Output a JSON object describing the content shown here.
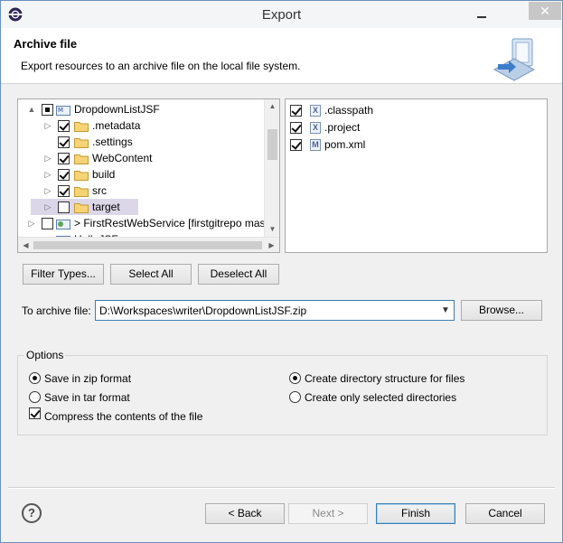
{
  "window": {
    "title": "Export",
    "close_glyph": "✕"
  },
  "banner": {
    "title": "Archive file",
    "description": "Export resources to an archive file on the local file system."
  },
  "tree": {
    "items": [
      {
        "label": "DropdownListJSF",
        "expander": "▲",
        "state": "partial"
      },
      {
        "label": ".metadata",
        "expander": "▷",
        "state": "checked"
      },
      {
        "label": ".settings",
        "expander": "",
        "state": "checked"
      },
      {
        "label": "WebContent",
        "expander": "▷",
        "state": "checked"
      },
      {
        "label": "build",
        "expander": "▷",
        "state": "checked"
      },
      {
        "label": "src",
        "expander": "▷",
        "state": "checked"
      },
      {
        "label": "target",
        "expander": "▷",
        "state": "unchecked",
        "selected": true
      },
      {
        "label": "> FirstRestWebService  [firstgitrepo mas",
        "expander": "▷",
        "state": "unchecked"
      },
      {
        "label": "HelloJSF",
        "expander": "",
        "state": "unchecked"
      }
    ]
  },
  "files": {
    "items": [
      {
        "label": ".classpath",
        "icon": "X"
      },
      {
        "label": ".project",
        "icon": "X"
      },
      {
        "label": "pom.xml",
        "icon": "M"
      }
    ]
  },
  "buttons": {
    "filter_types": "Filter Types...",
    "select_all": "Select All",
    "deselect_all": "Deselect All",
    "browse": "Browse...",
    "back": "< Back",
    "next": "Next >",
    "finish": "Finish",
    "cancel": "Cancel"
  },
  "archive": {
    "label": "To archive file:",
    "value": "D:\\Workspaces\\writer\\DropdownListJSF.zip"
  },
  "options": {
    "legend": "Options",
    "zip": "Save in zip format",
    "tar": "Save in tar format",
    "compress": "Compress the contents of the file",
    "dir_structure": "Create directory structure for files",
    "selected_dirs": "Create only selected directories"
  },
  "help_glyph": "?"
}
